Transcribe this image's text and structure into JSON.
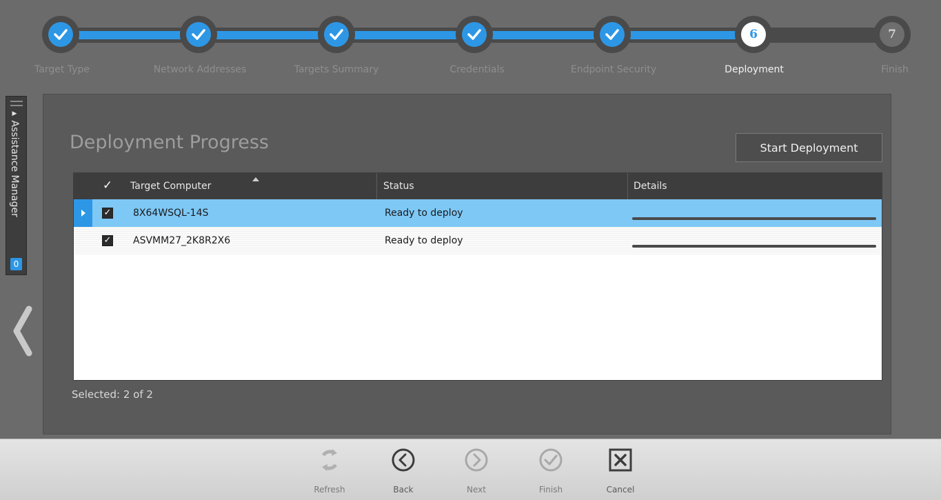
{
  "steps": [
    {
      "label": "Target Type",
      "state": "done"
    },
    {
      "label": "Network Addresses",
      "state": "done"
    },
    {
      "label": "Targets Summary",
      "state": "done"
    },
    {
      "label": "Credentials",
      "state": "done"
    },
    {
      "label": "Endpoint Security",
      "state": "done"
    },
    {
      "label": "Deployment",
      "state": "current",
      "number": "6"
    },
    {
      "label": "Finish",
      "state": "future",
      "number": "7"
    }
  ],
  "assistance": {
    "label": "Assistance Manager",
    "count": "0"
  },
  "panel": {
    "title": "Deployment Progress",
    "start_button": "Start Deployment"
  },
  "table": {
    "headers": {
      "target": "Target Computer",
      "status": "Status",
      "details": "Details"
    },
    "rows": [
      {
        "target": "8X64WSQL-14S",
        "status": "Ready to deploy",
        "checked": true,
        "selected": true
      },
      {
        "target": "ASVMM27_2K8R2X6",
        "status": "Ready to deploy",
        "checked": true,
        "selected": false
      }
    ]
  },
  "selected_count": "Selected: 2 of 2",
  "toolbar": {
    "refresh": "Refresh",
    "back": "Back",
    "next": "Next",
    "finish": "Finish",
    "cancel": "Cancel"
  },
  "colors": {
    "accent": "#2d97e6",
    "selected_row": "#7ec8f6",
    "panel": "#5a5a5a"
  }
}
